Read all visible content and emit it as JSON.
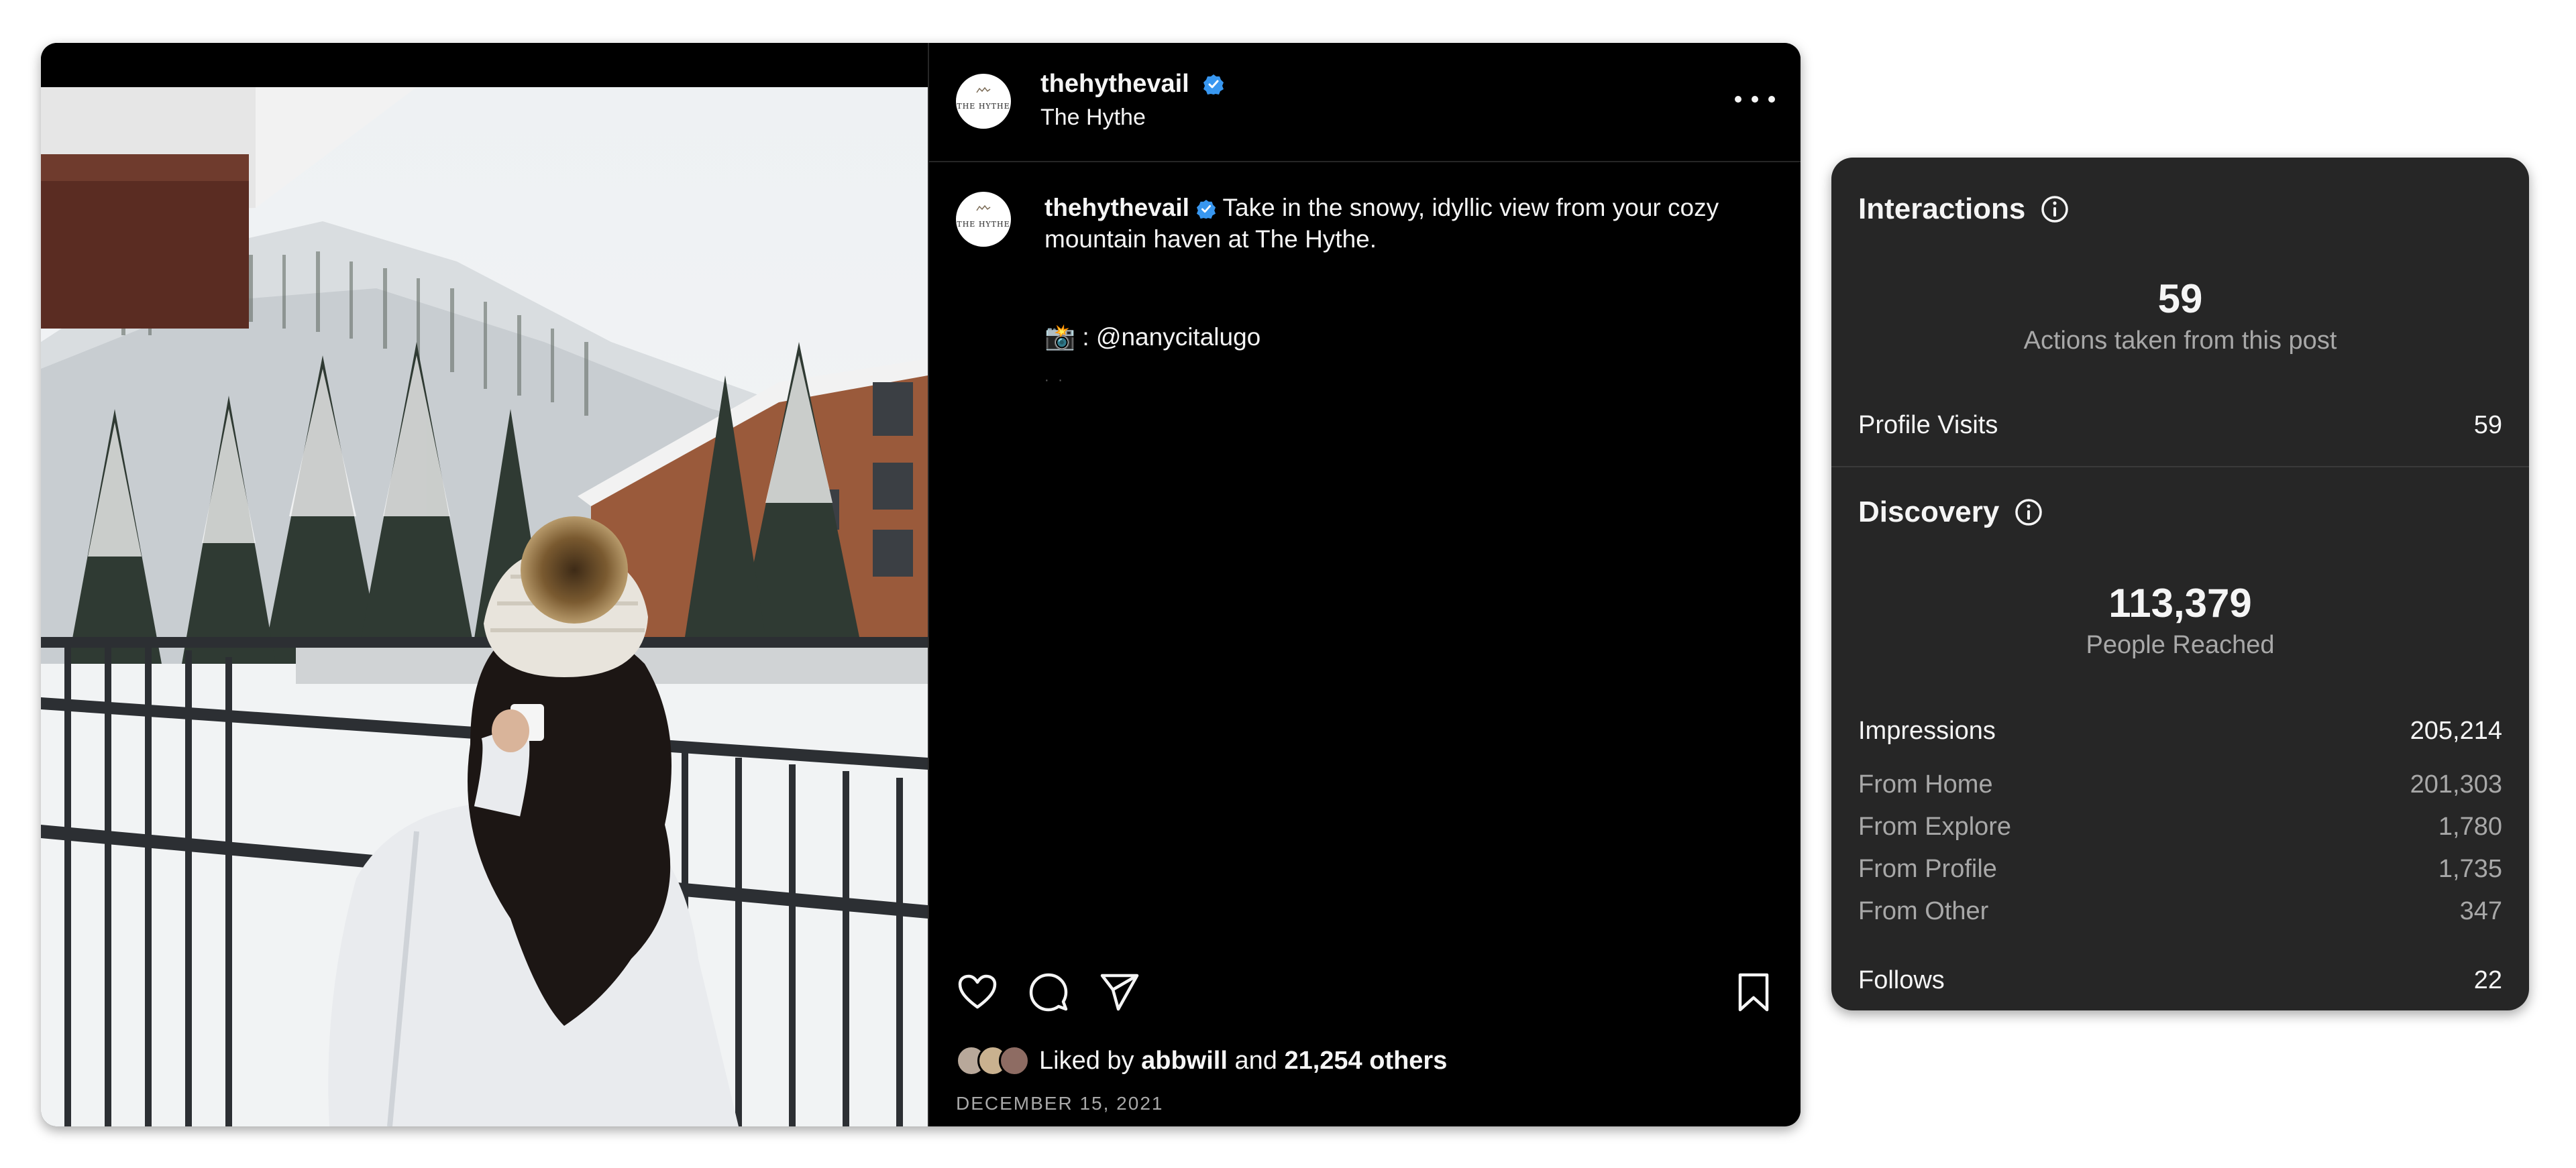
{
  "post": {
    "username": "thehythevail",
    "location": "The Hythe",
    "avatar_text": "THE HYTHE",
    "caption_username": "thehythevail",
    "caption_text": "Take in the snowy, idyllic view from your cozy mountain haven at The Hythe.",
    "credit": "📸 : @nanycitalugo",
    "likes_prefix": "Liked by",
    "likes_user": "abbwill",
    "likes_and": "and",
    "likes_others": "21,254 others",
    "date": "DECEMBER 15, 2021",
    "icons": [
      "heart-icon",
      "comment-icon",
      "share-icon",
      "bookmark-icon",
      "more-icon",
      "verified-badge-icon"
    ],
    "colors": {
      "background": "#000000",
      "verified": "#3897f0",
      "secondary_text": "#a8a8a8"
    }
  },
  "insights": {
    "interactions": {
      "title": "Interactions",
      "total": "59",
      "total_label": "Actions taken from this post",
      "rows": [
        {
          "label": "Profile Visits",
          "value": "59"
        }
      ]
    },
    "discovery": {
      "title": "Discovery",
      "total": "113,379",
      "total_label": "People Reached",
      "impressions": {
        "label": "Impressions",
        "value": "205,214"
      },
      "sources": [
        {
          "label": "From Home",
          "value": "201,303"
        },
        {
          "label": "From Explore",
          "value": "1,780"
        },
        {
          "label": "From Profile",
          "value": "1,735"
        },
        {
          "label": "From Other",
          "value": "347"
        }
      ],
      "follows": {
        "label": "Follows",
        "value": "22"
      }
    },
    "colors": {
      "card": "#262626",
      "muted_text": "#a8a8a8"
    }
  }
}
